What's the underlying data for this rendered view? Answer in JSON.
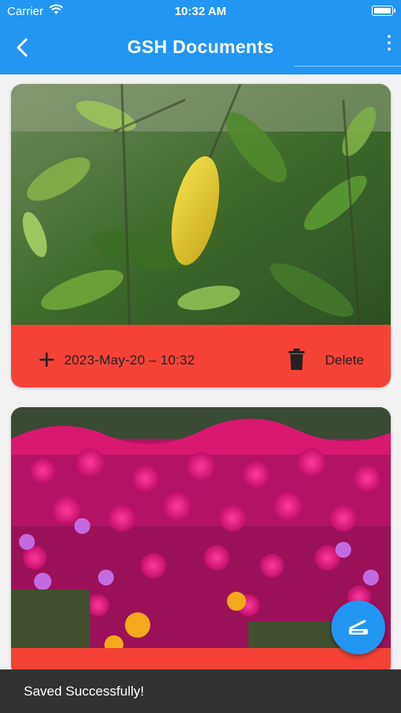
{
  "status_bar": {
    "carrier": "Carrier",
    "time": "10:32 AM"
  },
  "app_bar": {
    "title": "GSH Documents"
  },
  "documents": [
    {
      "image": "photo-green-leaves-with-yellow-leaf",
      "date": "2023-May-20 – 10:32",
      "delete_label": "Delete"
    },
    {
      "image": "photo-magenta-flowers"
    }
  ],
  "fab": {
    "icon": "scanner-icon"
  },
  "snackbar": {
    "message": "Saved Successfully!"
  },
  "colors": {
    "primary": "#2196f3",
    "card_footer": "#f44336",
    "snackbar": "#323232"
  }
}
